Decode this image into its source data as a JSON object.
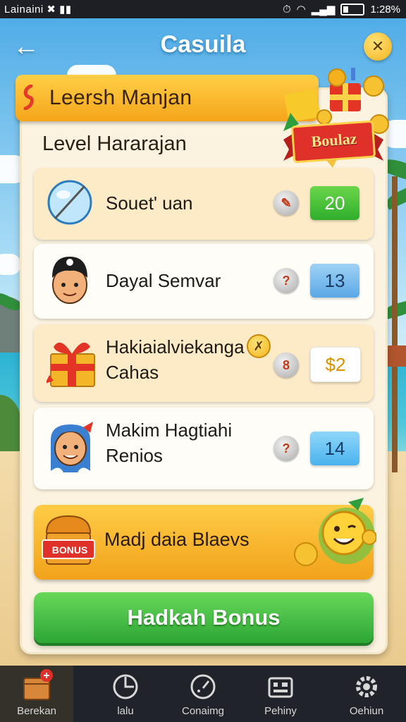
{
  "status_bar": {
    "left": "Lainaini  ✖  ▮▮",
    "right": "1:28%"
  },
  "header": {
    "title": "Casuila",
    "back_icon": "back-arrow-icon",
    "settings_icon": "gear-icon"
  },
  "banner": {
    "title": "Leersh Manjan",
    "badge": "Boulaz"
  },
  "subtitle": "Level Hararajan",
  "rows": [
    {
      "label": "Souet' uan",
      "value": "20",
      "value_style": "green",
      "icon": "balloon-icon"
    },
    {
      "label": "Dayal Semvar",
      "value": "13",
      "value_style": "blue",
      "icon": "avatar-boy-icon"
    },
    {
      "label_line1": "Hakiaialviekanga",
      "label_line2": "Cahas",
      "value": "$2",
      "value_style": "white",
      "icon": "gift-box-icon"
    },
    {
      "label_line1": "Makim Hagtiahi",
      "label_line2": "Renios",
      "value": "14",
      "value_style": "blue",
      "icon": "avatar-girl-icon"
    }
  ],
  "bonus_row": {
    "label": "Madj daia Blaevs",
    "chest_label": "BONUS"
  },
  "cta": {
    "label": "Hadkah Bonus"
  },
  "tabs": [
    {
      "label": "Berekan",
      "icon": "treasure-chest-icon",
      "active": true
    },
    {
      "label": "lalu",
      "icon": "chart-icon",
      "active": false
    },
    {
      "label": "Conaimg",
      "icon": "gauge-icon",
      "active": false
    },
    {
      "label": "Pehiny",
      "icon": "storage-icon",
      "active": false
    },
    {
      "label": "Oehiun",
      "icon": "settings-icon",
      "active": false
    }
  ],
  "colors": {
    "accent_orange": "#f5a51a",
    "cta_green": "#2ea635",
    "panel": "#fbf3e0"
  }
}
